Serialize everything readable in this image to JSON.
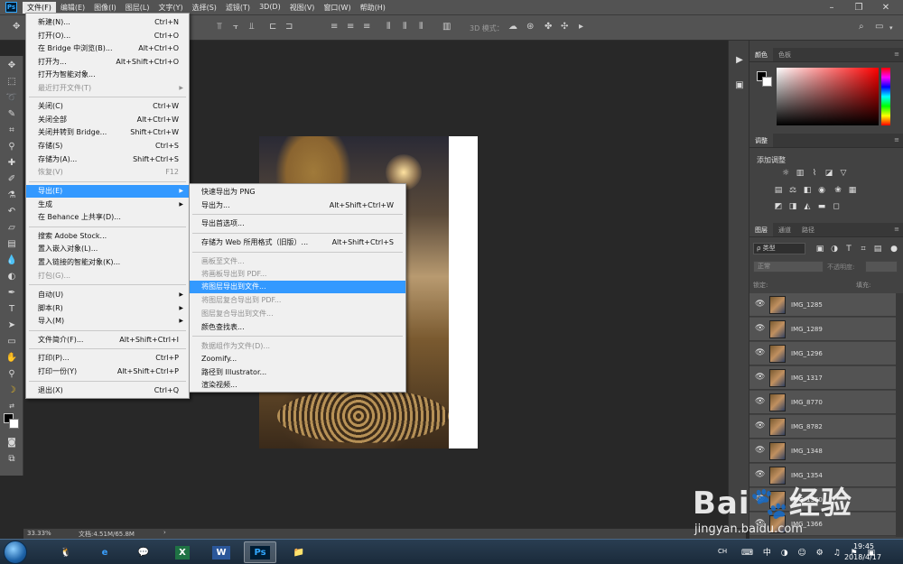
{
  "app": {
    "logo": "Ps"
  },
  "menubar": {
    "items": [
      "文件(F)",
      "编辑(E)",
      "图像(I)",
      "图层(L)",
      "文字(Y)",
      "选择(S)",
      "滤镜(T)",
      "3D(D)",
      "视图(V)",
      "窗口(W)",
      "帮助(H)"
    ],
    "active_index": 0,
    "window_controls": [
      "–",
      "❐",
      "✕"
    ]
  },
  "optionsbar": {
    "mode_label": "3D 模式："
  },
  "file_menu": {
    "items": [
      {
        "label": "新建(N)...",
        "shortcut": "Ctrl+N",
        "disabled": false
      },
      {
        "label": "打开(O)...",
        "shortcut": "Ctrl+O",
        "disabled": false
      },
      {
        "label": "在 Bridge 中浏览(B)...",
        "shortcut": "Alt+Ctrl+O",
        "disabled": false
      },
      {
        "label": "打开为...",
        "shortcut": "Alt+Shift+Ctrl+O",
        "disabled": false
      },
      {
        "label": "打开为智能对象...",
        "shortcut": "",
        "disabled": false
      },
      {
        "label": "最近打开文件(T)",
        "shortcut": "",
        "disabled": true,
        "submenu": true
      },
      {
        "label": "关闭(C)",
        "shortcut": "Ctrl+W",
        "disabled": false
      },
      {
        "label": "关闭全部",
        "shortcut": "Alt+Ctrl+W",
        "disabled": false
      },
      {
        "label": "关闭并转到 Bridge...",
        "shortcut": "Shift+Ctrl+W",
        "disabled": false
      },
      {
        "label": "存储(S)",
        "shortcut": "Ctrl+S",
        "disabled": false
      },
      {
        "label": "存储为(A)...",
        "shortcut": "Shift+Ctrl+S",
        "disabled": false
      },
      {
        "label": "恢复(V)",
        "shortcut": "F12",
        "disabled": true
      },
      {
        "label": "导出(E)",
        "shortcut": "",
        "disabled": false,
        "submenu": true,
        "highlighted": true
      },
      {
        "label": "生成",
        "shortcut": "",
        "disabled": false,
        "submenu": true
      },
      {
        "label": "在 Behance 上共享(D)...",
        "shortcut": "",
        "disabled": false
      },
      {
        "label": "搜索 Adobe Stock...",
        "shortcut": "",
        "disabled": false
      },
      {
        "label": "置入嵌入对象(L)...",
        "shortcut": "",
        "disabled": false
      },
      {
        "label": "置入链接的智能对象(K)...",
        "shortcut": "",
        "disabled": false
      },
      {
        "label": "打包(G)...",
        "shortcut": "",
        "disabled": true
      },
      {
        "label": "自动(U)",
        "shortcut": "",
        "disabled": false,
        "submenu": true
      },
      {
        "label": "脚本(R)",
        "shortcut": "",
        "disabled": false,
        "submenu": true
      },
      {
        "label": "导入(M)",
        "shortcut": "",
        "disabled": false,
        "submenu": true
      },
      {
        "label": "文件简介(F)...",
        "shortcut": "Alt+Shift+Ctrl+I",
        "disabled": false
      },
      {
        "label": "打印(P)...",
        "shortcut": "Ctrl+P",
        "disabled": false
      },
      {
        "label": "打印一份(Y)",
        "shortcut": "Alt+Shift+Ctrl+P",
        "disabled": false
      },
      {
        "label": "退出(X)",
        "shortcut": "Ctrl+Q",
        "disabled": false
      }
    ]
  },
  "export_menu": {
    "items": [
      {
        "label": "快速导出为 PNG",
        "shortcut": "",
        "disabled": false
      },
      {
        "label": "导出为...",
        "shortcut": "Alt+Shift+Ctrl+W",
        "disabled": false
      },
      {
        "label": "导出首选项...",
        "shortcut": "",
        "disabled": false
      },
      {
        "label": "存储为 Web 所用格式（旧版）...",
        "shortcut": "Alt+Shift+Ctrl+S",
        "disabled": false
      },
      {
        "label": "画板至文件...",
        "shortcut": "",
        "disabled": true
      },
      {
        "label": "将画板导出到 PDF...",
        "shortcut": "",
        "disabled": true
      },
      {
        "label": "将图层导出到文件...",
        "shortcut": "",
        "disabled": false,
        "highlighted": true
      },
      {
        "label": "将图层复合导出到 PDF...",
        "shortcut": "",
        "disabled": true
      },
      {
        "label": "图层复合导出到文件...",
        "shortcut": "",
        "disabled": true
      },
      {
        "label": "颜色查找表...",
        "shortcut": "",
        "disabled": false
      },
      {
        "label": "数据组作为文件(D)...",
        "shortcut": "",
        "disabled": true
      },
      {
        "label": "Zoomify...",
        "shortcut": "",
        "disabled": false
      },
      {
        "label": "路径到 Illustrator...",
        "shortcut": "",
        "disabled": false
      },
      {
        "label": "渲染视频...",
        "shortcut": "",
        "disabled": false
      }
    ]
  },
  "panels": {
    "color_tabs": [
      "颜色",
      "色板"
    ],
    "adjust_tab": "调整",
    "adjust_title": "添加调整",
    "layer_tabs": [
      "图层",
      "通道",
      "路径"
    ],
    "layer_filter": "ρ 类型",
    "blend_mode": "正常",
    "opacity_label": "不透明度:",
    "lock_label": "锁定:",
    "fill_label": "填充:",
    "layers": [
      "IMG_1285",
      "IMG_1289",
      "IMG_1296",
      "IMG_1317",
      "IMG_8770",
      "IMG_8782",
      "IMG_1348",
      "IMG_1354",
      "IMG_1360",
      "IMG_1366"
    ]
  },
  "statusbar": {
    "zoom": "33.33%",
    "doc_size": "文档:4.51M/65.8M",
    "arrow": "›"
  },
  "taskbar": {
    "apps": [
      {
        "name": "qq",
        "label": "🐧"
      },
      {
        "name": "ie",
        "label": "e"
      },
      {
        "name": "wechat",
        "label": "💬"
      },
      {
        "name": "excel",
        "label": "X"
      },
      {
        "name": "word",
        "label": "W"
      },
      {
        "name": "photoshop",
        "label": "Ps"
      },
      {
        "name": "explorer",
        "label": "📁"
      }
    ],
    "lang": "CH",
    "time": "19:45",
    "date": "2018/4/17"
  },
  "watermark": {
    "logo": "Bai🐾经验",
    "url": "jingyan.baidu.com"
  },
  "colors": {
    "menu_highlight": "#3399ff",
    "ps_blue": "#31a8ff",
    "workspace": "#282828",
    "panel": "#424242"
  }
}
